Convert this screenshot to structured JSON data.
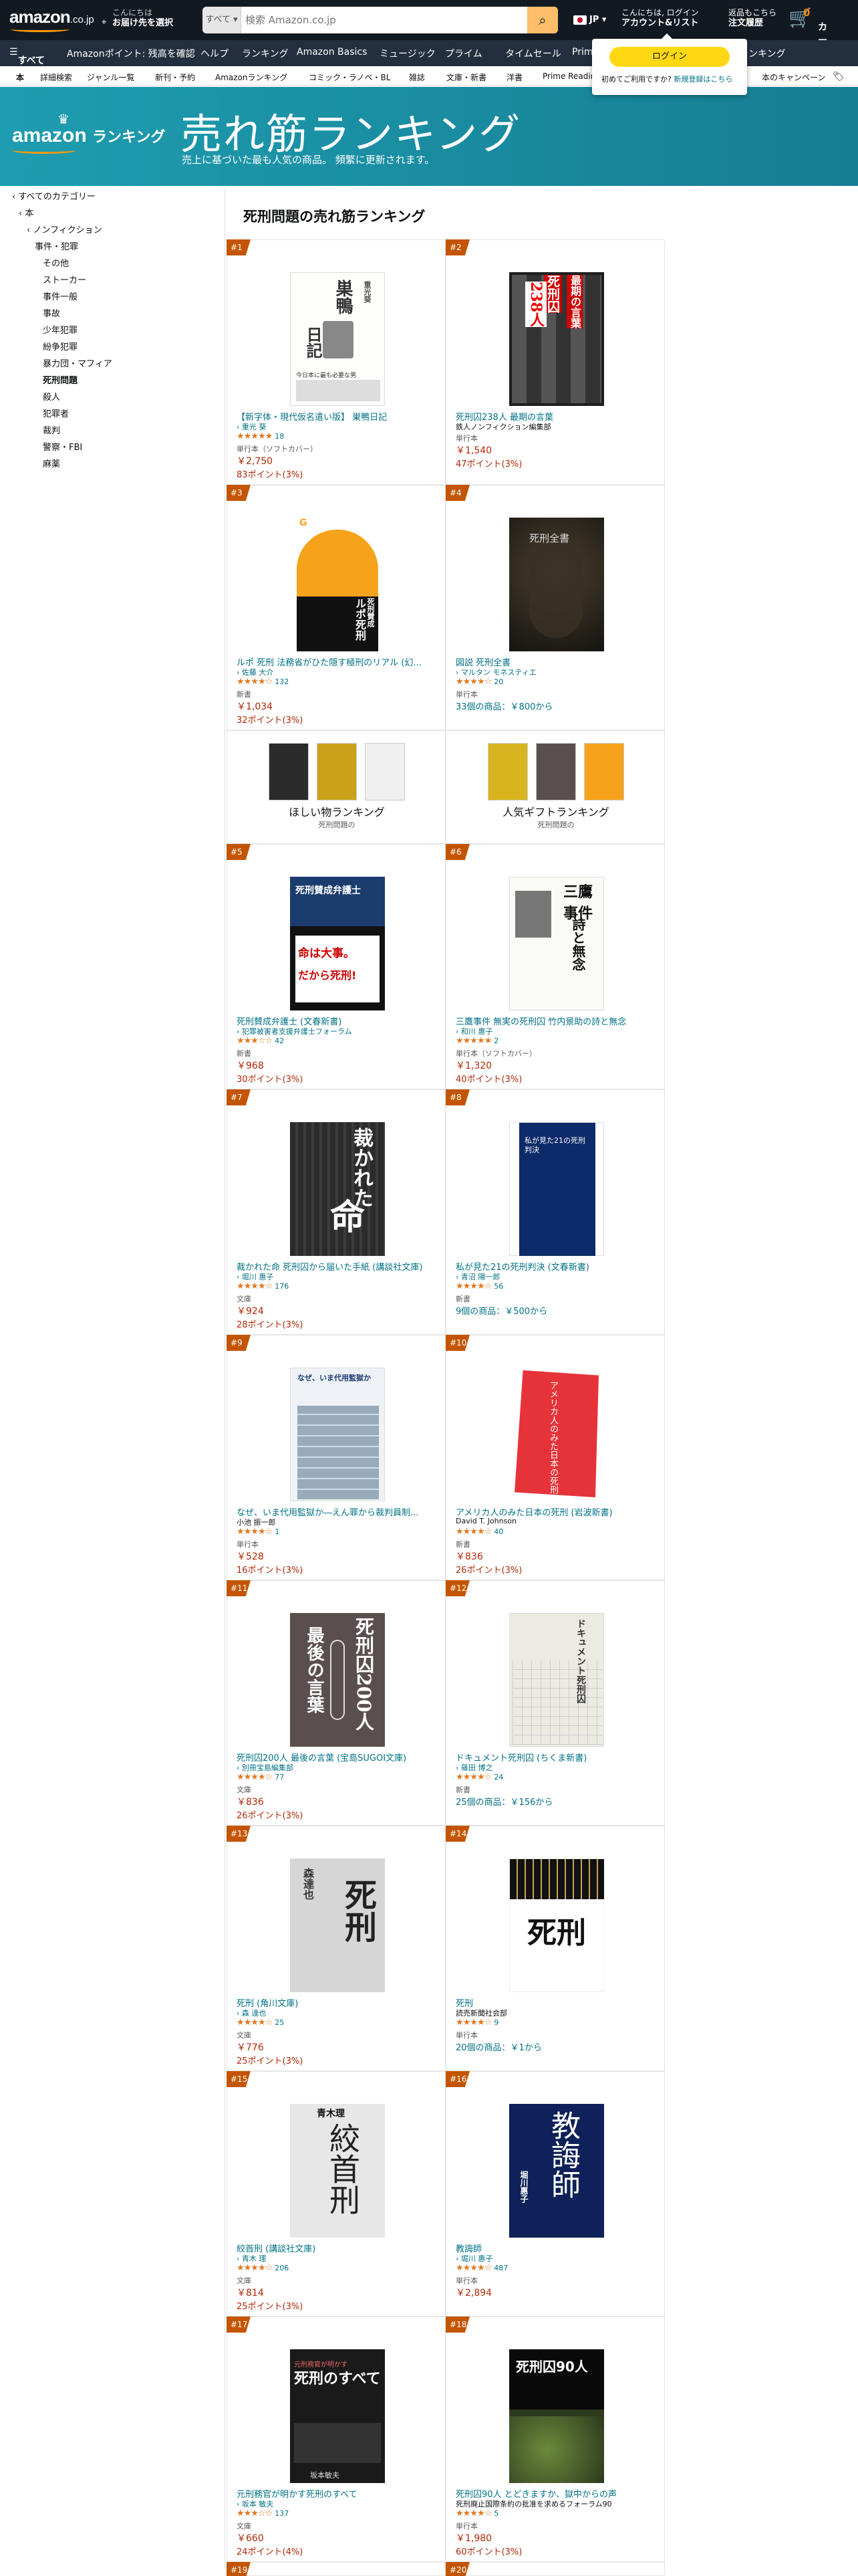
{
  "header": {
    "logo": "amazon",
    "logo_suffix": ".co.jp",
    "deliver_line1": "こんにちは",
    "deliver_line2": "お届け先を選択",
    "search_category": "すべて",
    "search_placeholder": "検索 Amazon.co.jp",
    "lang": "JP",
    "account_line1": "こんにちは, ログイン",
    "account_line2": "アカウント&リスト",
    "orders_line1": "返品もこちら",
    "orders_line2": "注文履歴",
    "cart_label": "カート",
    "cart_count": "0"
  },
  "subnav": {
    "all": "すべて",
    "items": [
      "Amazonポイント: 残高を確認",
      "ヘルプ",
      "ランキング",
      "Amazon Basics",
      "ミュージック",
      "プライム",
      "タイムセール",
      "Prim",
      "ンキング"
    ]
  },
  "strip": {
    "items": [
      "本",
      "詳細検索",
      "ジャンル一覧",
      "新刊・予約",
      "Amazonランキング",
      "コミック・ラノベ・BL",
      "雑誌",
      "文庫・新書",
      "洋書",
      "Prime Readin",
      "本のキャンペーン"
    ]
  },
  "login_popup": {
    "button": "ログイン",
    "prompt": "初めてご利用ですか?",
    "register": "新規登録はこちら"
  },
  "banner": {
    "logo": "amazon",
    "logo_suffix": "ランキング",
    "title": "売れ筋ランキング",
    "subtitle": "売上に基づいた最も人気の商品。 頻繁に更新されます。"
  },
  "sidebar": {
    "items": [
      "‹ すべてのカテゴリー",
      "‹ 本",
      "‹ ノンフィクション",
      "事件・犯罪",
      "その他",
      "ストーカー",
      "事件一般",
      "事故",
      "少年犯罪",
      "紛争犯罪",
      "暴力団・マフィア",
      "死刑問題",
      "殺人",
      "犯罪者",
      "裁判",
      "警察・FBI",
      "麻薬"
    ]
  },
  "main": {
    "heading": "死刑問題の売れ筋ランキング"
  },
  "promos": [
    {
      "title": "ほしい物ランキング",
      "sub": "死刑問題の"
    },
    {
      "title": "人気ギフトランキング",
      "sub": "死刑問題の"
    }
  ],
  "products": [
    {
      "rank": "#1",
      "title": "【新字体・現代仮名遣い版】 巣鴨日記",
      "author": "› 重光 葵",
      "count": "18",
      "stars": "★★★★★",
      "format": "単行本（ソフトカバー）",
      "price": "￥2,750",
      "points": "83ポイント(3%)"
    },
    {
      "rank": "#2",
      "title": "死刑囚238人 最期の言葉",
      "author": "鉄人ノンフィクション編集部",
      "count": "",
      "stars": "",
      "format": "単行本",
      "price": "￥1,540",
      "points": "47ポイント(3%)"
    },
    {
      "rank": "#3",
      "title": "ルポ 死刑 法務省がひた隠す極刑のリアル (幻...",
      "author": "› 佐藤 大介",
      "count": "132",
      "stars": "★★★★☆",
      "format": "新書",
      "price": "￥1,034",
      "points": "32ポイント(3%)"
    },
    {
      "rank": "#4",
      "title": "図説 死刑全書",
      "author": "› マルタン モネスティエ",
      "count": "20",
      "stars": "★★★★☆",
      "format": "単行本",
      "offers": "33個の商品：￥800から"
    },
    {
      "rank": "#5",
      "title": "死刑賛成弁護士 (文春新書)",
      "author": "› 犯罪被害者支援弁護士フォーラム",
      "count": "42",
      "stars": "★★★☆☆",
      "format": "新書",
      "price": "￥968",
      "points": "30ポイント(3%)"
    },
    {
      "rank": "#6",
      "title": "三鷹事件 無実の死刑囚 竹内景助の詩と無念",
      "author": "› 和川 惠子",
      "count": "2",
      "stars": "★★★★★",
      "format": "単行本（ソフトカバー）",
      "price": "￥1,320",
      "points": "40ポイント(3%)"
    },
    {
      "rank": "#7",
      "title": "裁かれた命 死刑囚から届いた手紙 (講談社文庫)",
      "author": "› 堀川 惠子",
      "count": "176",
      "stars": "★★★★☆",
      "format": "文庫",
      "price": "￥924",
      "points": "28ポイント(3%)"
    },
    {
      "rank": "#8",
      "title": "私が見た21の死刑判決 (文春新書)",
      "author": "› 青沼 陽一郎",
      "count": "56",
      "stars": "★★★★☆",
      "format": "新書",
      "offers": "9個の商品：￥500から"
    },
    {
      "rank": "#9",
      "title": "なぜ、いま代用監獄か―えん罪から裁判員制...",
      "author": "小池 振一郎",
      "count": "1",
      "stars": "★★★★☆",
      "format": "単行本",
      "price": "￥528",
      "points": "16ポイント(3%)"
    },
    {
      "rank": "#10",
      "title": "アメリカ人のみた日本の死刑 (岩波新書)",
      "author": "David T. Johnson",
      "count": "40",
      "stars": "★★★★☆",
      "format": "新書",
      "price": "￥836",
      "points": "26ポイント(3%)"
    },
    {
      "rank": "#11",
      "title": "死刑囚200人 最後の言葉 (宝島SUGOI文庫)",
      "author": "› 別冊宝島編集部",
      "count": "77",
      "stars": "★★★★☆",
      "format": "文庫",
      "price": "￥836",
      "points": "26ポイント(3%)"
    },
    {
      "rank": "#12",
      "title": "ドキュメント死刑囚 (ちくま新書)",
      "author": "› 篠田 博之",
      "count": "24",
      "stars": "★★★★☆",
      "format": "新書",
      "offers": "25個の商品：￥156から"
    },
    {
      "rank": "#13",
      "title": "死刑 (角川文庫)",
      "author": "› 森 達也",
      "count": "25",
      "stars": "★★★★☆",
      "format": "文庫",
      "price": "￥776",
      "points": "25ポイント(3%)"
    },
    {
      "rank": "#14",
      "title": "死刑",
      "author": "読売新聞社会部",
      "count": "9",
      "stars": "★★★★☆",
      "format": "単行本",
      "offers": "20個の商品：￥1から"
    },
    {
      "rank": "#15",
      "title": "絞首刑 (講談社文庫)",
      "author": "› 青木 理",
      "count": "206",
      "stars": "★★★★☆",
      "format": "文庫",
      "price": "￥814",
      "points": "25ポイント(3%)"
    },
    {
      "rank": "#16",
      "title": "教誨師",
      "author": "› 堀川 惠子",
      "count": "487",
      "stars": "★★★★☆",
      "format": "単行本",
      "price": "￥2,894",
      "points": ""
    },
    {
      "rank": "#17",
      "title": "元刑務官が明かす死刑のすべて",
      "author": "› 坂本 敏夫",
      "count": "137",
      "stars": "★★★☆☆",
      "format": "文庫",
      "price": "￥660",
      "points": "24ポイント(4%)"
    },
    {
      "rank": "#18",
      "title": "死刑囚90人 とどきますか、獄中からの声",
      "author": "死刑廃止国際条約の批准を求めるフォーラム90",
      "count": "5",
      "stars": "★★★★☆",
      "format": "単行本",
      "price": "￥1,980",
      "points": "60ポイント(3%)"
    }
  ],
  "partial_ranks": [
    "#19",
    "#20"
  ],
  "covers": {
    "c1_top": "巣鴨",
    "c1_mid": "日記",
    "c1_sub": "今日本に最も必要な男",
    "c1_author": "重光葵",
    "c2_l1": "死刑囚",
    "c2_l2": "238人",
    "c2_l3": "最期の言葉",
    "c3_title": "ルポ死刑",
    "c3_sub": "死刑賛成",
    "c4_title": "死刑全書",
    "c5_top": "死刑賛成弁護士",
    "c5_big1": "命は大事。",
    "c5_big2": "だから死刑!",
    "c6_title": "三鷹事件",
    "c6_sub": "詩と無念",
    "c7_title": "裁かれた",
    "c7_big": "命",
    "c8_title": "私が見た21の死刑判決",
    "c9_title": "なぜ、いま代用監獄か",
    "c10_title": "アメリカ人のみた日本の死刑",
    "c11_l1": "最後の言葉",
    "c11_l2": "死刑囚200人",
    "c12_title": "ドキュメント死刑囚",
    "c13_author": "森達也",
    "c13_title": "死刑",
    "c14_title": "死刑",
    "c15_author": "青木理",
    "c15_title": "絞首刑",
    "c16_title": "教誨師",
    "c16_author": "堀川惠子",
    "c17_top": "元刑務官が明かす",
    "c17_big": "死刑のすべて",
    "c17_author": "坂本敏夫",
    "c18_title": "死刑囚90人"
  },
  "colors": {
    "header": "#131921",
    "subnav": "#232f3e",
    "banner": "#1a8ea3",
    "rank_badge": "#c45500",
    "link": "#007185",
    "price": "#b12704",
    "stars": "#de7921"
  }
}
